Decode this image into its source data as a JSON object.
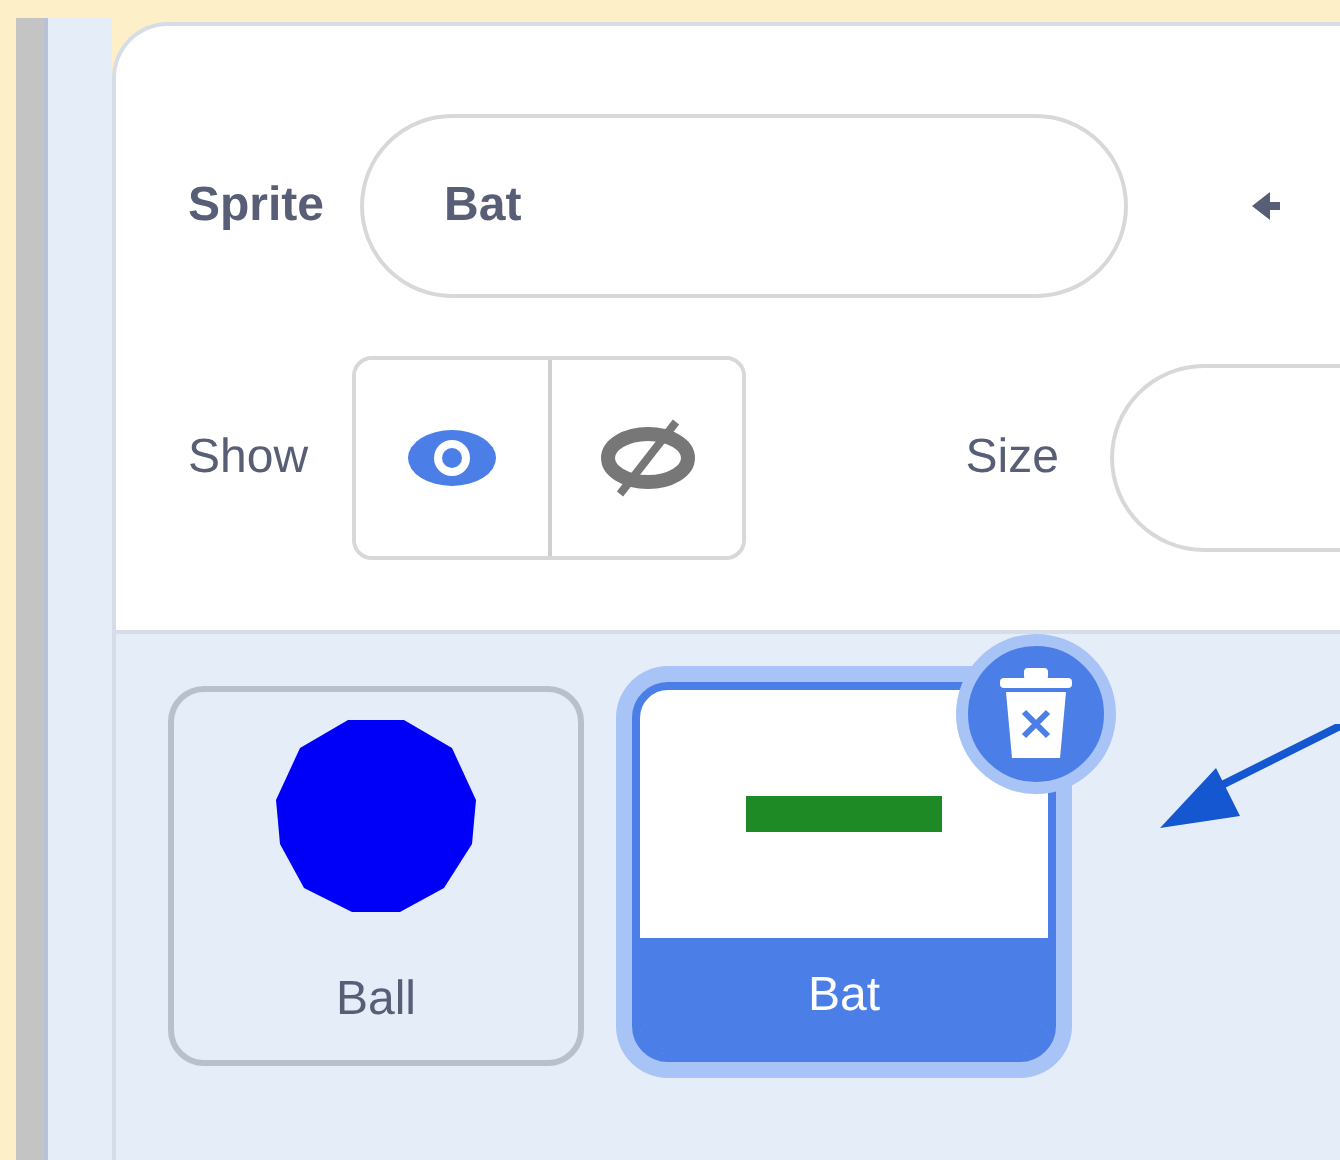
{
  "sprite_info": {
    "sprite_label": "Sprite",
    "sprite_name": "Bat",
    "show_label": "Show",
    "show_options": [
      {
        "kind": "visible",
        "selected": true
      },
      {
        "kind": "hidden",
        "selected": false
      }
    ],
    "size_label": "Size"
  },
  "sprites": [
    {
      "name": "Ball",
      "kind": "circle",
      "selected": false
    },
    {
      "name": "Bat",
      "kind": "bar",
      "selected": true
    }
  ]
}
